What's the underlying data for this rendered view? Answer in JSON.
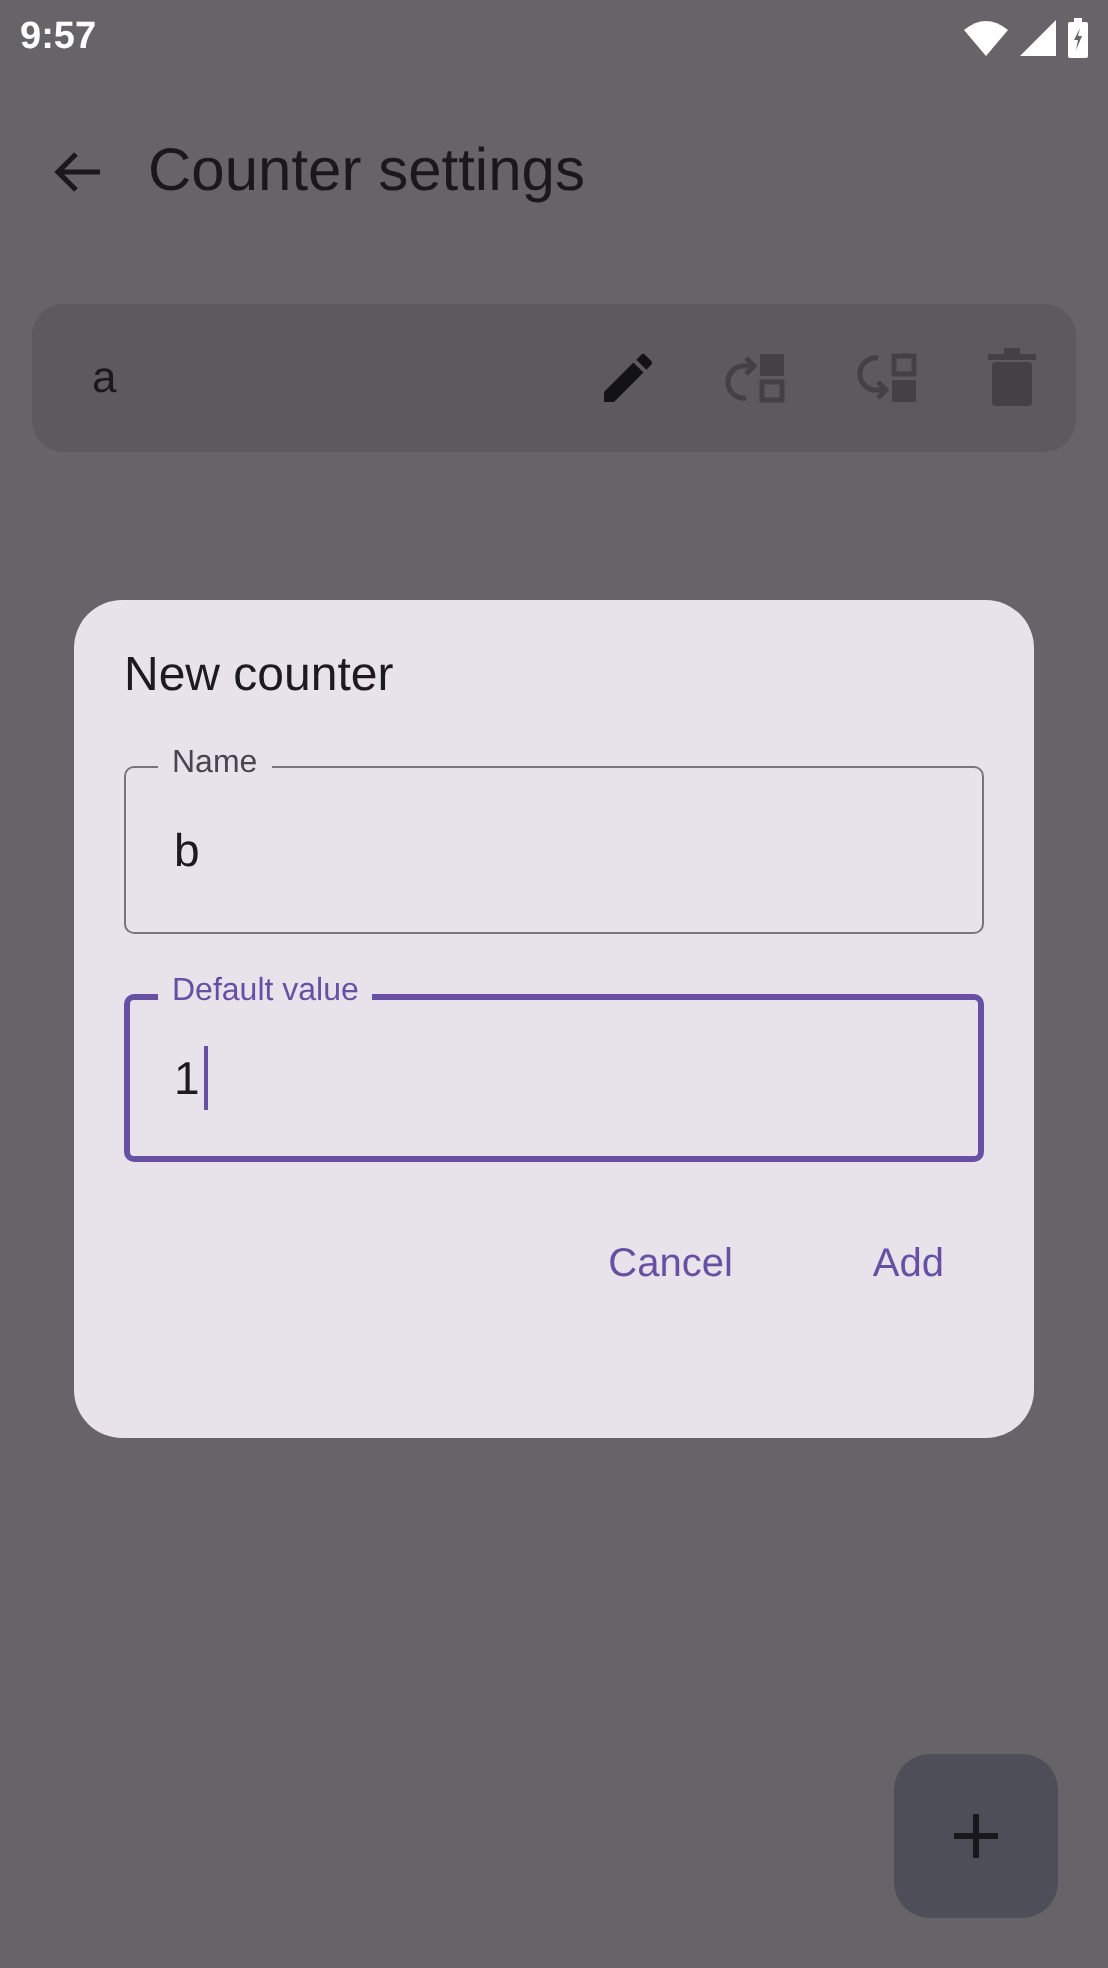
{
  "status_bar": {
    "time": "9:57"
  },
  "app_bar": {
    "title": "Counter settings"
  },
  "counters": [
    {
      "name": "a",
      "actions": [
        {
          "kind": "edit",
          "disabled": false
        },
        {
          "kind": "move-up",
          "disabled": true
        },
        {
          "kind": "move-down",
          "disabled": true
        },
        {
          "kind": "delete",
          "disabled": true
        }
      ]
    }
  ],
  "dialog": {
    "title": "New counter",
    "fields": [
      {
        "label": "Name",
        "value": "b",
        "focused": false
      },
      {
        "label": "Default value",
        "value": "1",
        "focused": true
      }
    ],
    "buttons": [
      "Cancel",
      "Add"
    ]
  }
}
